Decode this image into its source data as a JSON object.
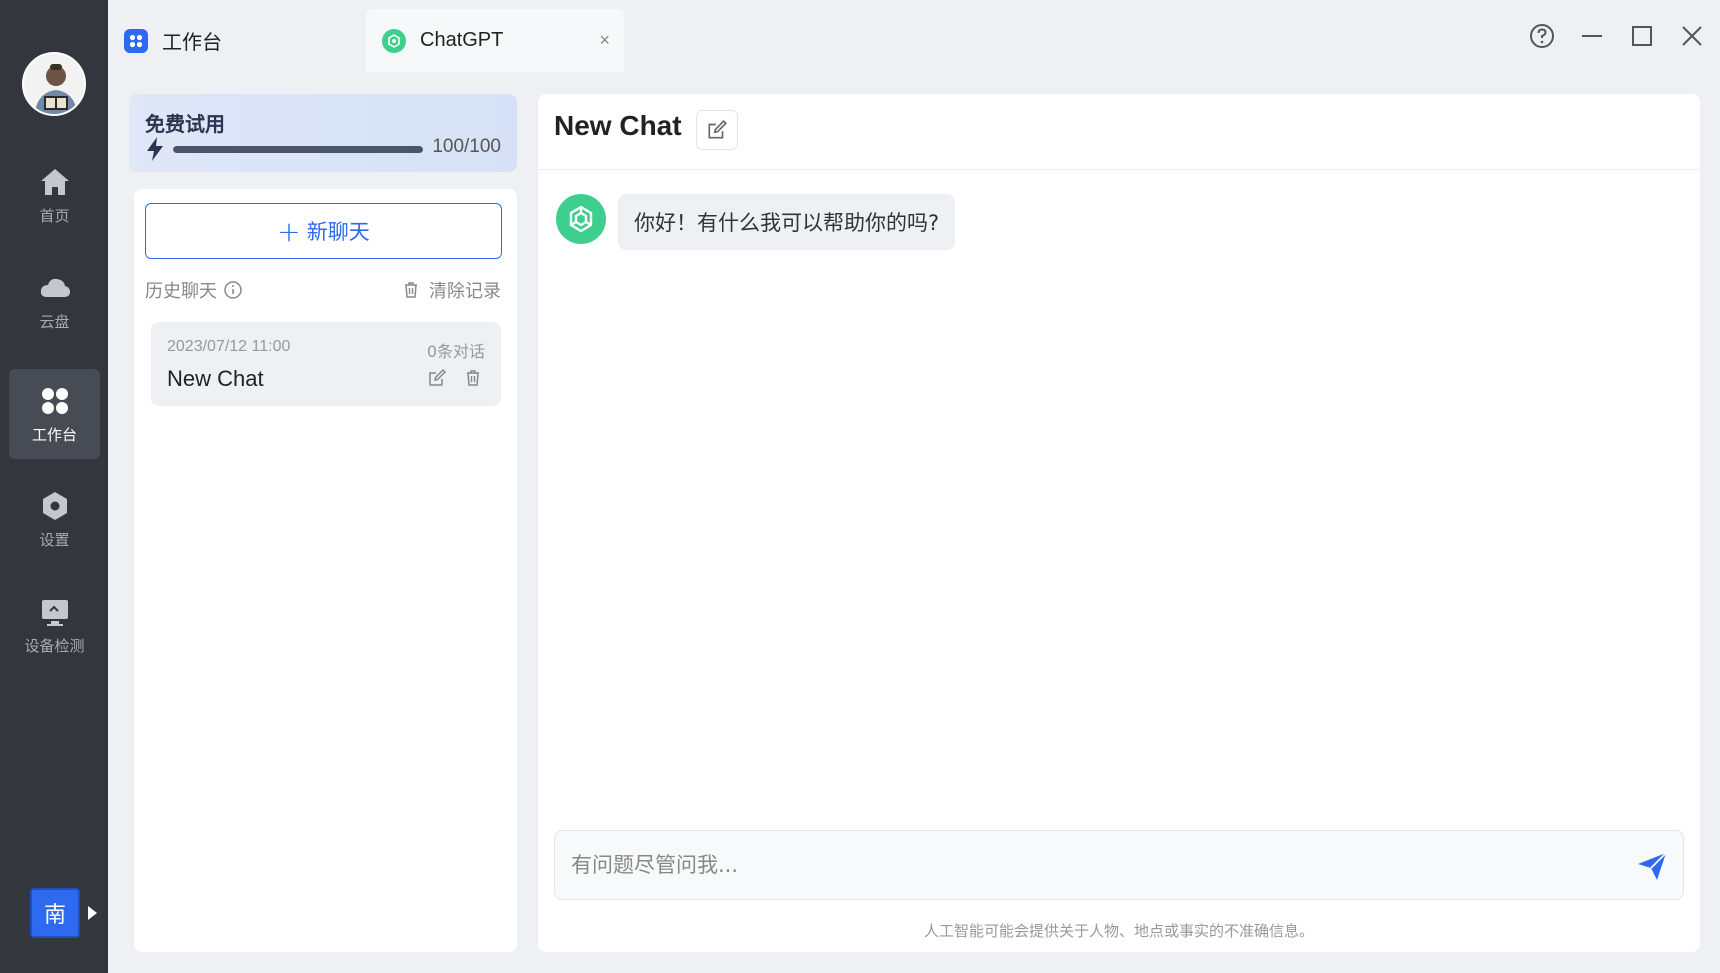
{
  "sidebar": {
    "items": [
      {
        "label": "首页",
        "icon": "home-icon"
      },
      {
        "label": "云盘",
        "icon": "cloud-icon"
      },
      {
        "label": "工作台",
        "icon": "workbench-icon",
        "active": true
      },
      {
        "label": "设置",
        "icon": "settings-icon"
      },
      {
        "label": "设备检测",
        "icon": "device-check-icon"
      }
    ],
    "user_initial": "南"
  },
  "tabs": [
    {
      "label": "工作台",
      "icon": "workbench-icon"
    },
    {
      "label": "ChatGPT",
      "icon": "chatgpt-icon",
      "active": true,
      "close": "×"
    }
  ],
  "trial": {
    "title": "免费试用",
    "count": "100/100",
    "progress_fraction": 1.0
  },
  "left_panel": {
    "new_chat_label": "新聊天",
    "history_label": "历史聊天",
    "clear_label": "清除记录",
    "chats": [
      {
        "date": "2023/07/12 11:00",
        "count": "0条对话",
        "name": "New Chat"
      }
    ]
  },
  "main": {
    "title": "New Chat",
    "messages": [
      {
        "role": "assistant",
        "text": "你好！有什么我可以帮助你的吗?"
      }
    ],
    "input_placeholder": "有问题尽管问我...",
    "disclaimer": "人工智能可能会提供关于人物、地点或事实的不准确信息。"
  },
  "colors": {
    "accent": "#2e6af0",
    "sidebar_bg": "#33363d",
    "chatgpt_green": "#3ecf8e"
  }
}
